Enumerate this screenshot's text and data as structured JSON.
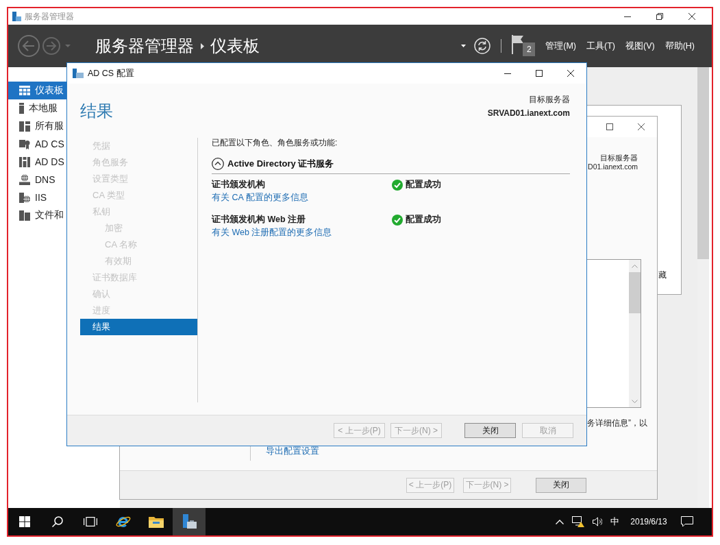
{
  "window": {
    "title": "服务器管理器"
  },
  "header": {
    "breadcrumb": [
      "服务器管理器",
      "仪表板"
    ],
    "notification_count": "2",
    "menus": [
      "管理(M)",
      "工具(T)",
      "视图(V)",
      "帮助(H)"
    ]
  },
  "sidebar": {
    "items": [
      {
        "label": "仪表板",
        "selected": true
      },
      {
        "label": "本地服",
        "selected": false
      },
      {
        "label": "所有服",
        "selected": false
      },
      {
        "label": "AD CS",
        "selected": false
      },
      {
        "label": "AD DS",
        "selected": false
      },
      {
        "label": "DNS",
        "selected": false
      },
      {
        "label": "IIS",
        "selected": false
      },
      {
        "label": "文件和",
        "selected": false
      }
    ]
  },
  "background_tile": {
    "text": "藏"
  },
  "background_wizard": {
    "target_server_label": "目标服务器",
    "target_server": "D01.ianext.com",
    "description": "务详细信息”，以",
    "export_link": "导出配置设置",
    "buttons": [
      {
        "label": "< 上一步(P)",
        "disabled": true
      },
      {
        "label": "下一步(N) >",
        "disabled": true
      },
      {
        "label": "关闭",
        "disabled": false
      }
    ]
  },
  "dialog": {
    "title": "AD CS 配置",
    "heading": "结果",
    "target_server_label": "目标服务器",
    "target_server": "SRVAD01.ianext.com",
    "nav": [
      {
        "label": "凭据",
        "selected": false
      },
      {
        "label": "角色服务",
        "selected": false
      },
      {
        "label": "设置类型",
        "selected": false
      },
      {
        "label": "CA 类型",
        "selected": false
      },
      {
        "label": "私钥",
        "selected": false,
        "children": [
          {
            "label": "加密",
            "selected": false
          },
          {
            "label": "CA 名称",
            "selected": false
          },
          {
            "label": "有效期",
            "selected": false
          }
        ]
      },
      {
        "label": "证书数据库",
        "selected": false
      },
      {
        "label": "确认",
        "selected": false
      },
      {
        "label": "进度",
        "selected": false
      },
      {
        "label": "结果",
        "selected": true
      }
    ],
    "intro": "已配置以下角色、角色服务或功能:",
    "group": {
      "title": "Active Directory 证书服务",
      "expanded": true
    },
    "results": [
      {
        "name": "证书颁发机构",
        "succeeded": true,
        "status": "配置成功",
        "link": "有关 CA 配置的更多信息"
      },
      {
        "name": "证书颁发机构 Web 注册",
        "succeeded": true,
        "status": "配置成功",
        "link": "有关 Web 注册配置的更多信息"
      }
    ],
    "buttons": [
      {
        "label": "< 上一步(P)",
        "disabled": true
      },
      {
        "label": "下一步(N) >",
        "disabled": true
      },
      {
        "label": "关闭",
        "disabled": false
      },
      {
        "label": "取消",
        "disabled": true
      }
    ]
  },
  "taskbar": {
    "apps": [
      {
        "selected": false
      },
      {
        "selected": false
      },
      {
        "selected": true
      }
    ],
    "input_method": "中",
    "date": "2019/6/13"
  }
}
